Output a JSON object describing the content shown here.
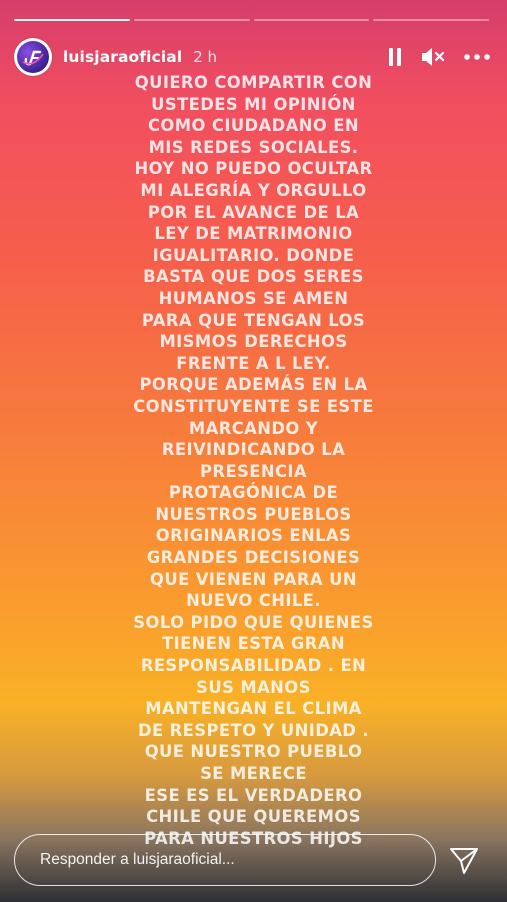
{
  "story": {
    "progress": {
      "segments": 4,
      "current": 1
    },
    "username": "luisjaraoficial",
    "time": "2 h",
    "controls": {
      "pause_icon": "pause-icon",
      "mute_icon": "muted-speaker-icon",
      "more_icon": "more-options-icon"
    }
  },
  "caption_lines": [
    "QUIERO COMPARTIR CON",
    "USTEDES MI OPINIÓN",
    "COMO CIUDADANO EN",
    "MIS REDES SOCIALES.",
    "HOY NO PUEDO OCULTAR",
    "MI ALEGRÍA Y ORGULLO",
    "POR EL AVANCE DE LA",
    "LEY DE MATRIMONIO",
    "IGUALITARIO. DONDE",
    "BASTA QUE DOS SERES",
    "HUMANOS SE AMEN",
    "PARA QUE TENGAN LOS",
    "MISMOS DERECHOS",
    "FRENTE A L LEY.",
    "PORQUE ADEMÁS EN LA",
    "CONSTITUYENTE SE ESTE",
    "MARCANDO Y",
    "REIVINDICANDO LA",
    "PRESENCIA",
    "PROTAGÓNICA DE",
    "NUESTROS PUEBLOS",
    "ORIGINARIOS ENLAS",
    "GRANDES DECISIONES",
    "QUE VIENEN PARA UN",
    "NUEVO CHILE.",
    "SOLO PIDO QUE QUIENES",
    "TIENEN ESTA GRAN",
    "RESPONSABILIDAD . EN",
    "SUS MANOS",
    "MANTENGAN EL CLIMA",
    "DE RESPETO Y UNIDAD .",
    "QUE NUESTRO PUEBLO",
    "SE MERECE",
    "ESE ES EL VERDADERO",
    "CHILE QUE QUEREMOS",
    "PARA NUESTROS HIJOS"
  ],
  "reply": {
    "placeholder": "Responder a luisjaraoficial...",
    "send_icon": "send-icon"
  }
}
